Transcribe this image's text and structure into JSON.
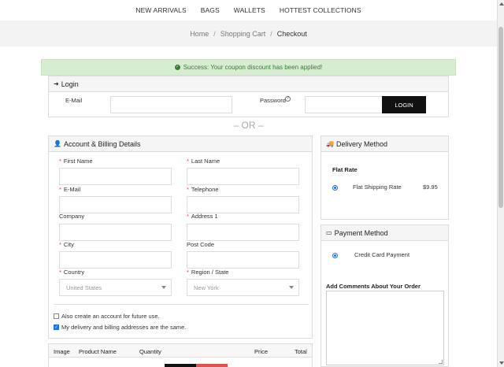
{
  "nav": {
    "items": [
      "NEW ARRIVALS",
      "BAGS",
      "WALLETS",
      "HOTTEST COLLECTIONS"
    ]
  },
  "breadcrumb": {
    "home": "Home",
    "cart": "Shopping Cart",
    "current": "Checkout",
    "separator": "/"
  },
  "alert": {
    "message": "Success: Your coupon discount has been applied!",
    "color": "#3c7a35"
  },
  "login": {
    "title": "Login",
    "email_label": "E-Mail",
    "password_label": "Password",
    "button": "LOGIN"
  },
  "divider": "– OR –",
  "billing": {
    "title": "Account & Billing Details",
    "first_name": "First Name",
    "last_name": "Last Name",
    "email": "E-Mail",
    "telephone": "Telephone",
    "company": "Company",
    "address1": "Address 1",
    "city": "City",
    "post_code": "Post Code",
    "country": "Country",
    "country_value": "United States",
    "region": "Region / State",
    "region_value": "New York",
    "create_account": "Also create an account for future use.",
    "same_address": "My delivery and billing addresses are the same."
  },
  "cart": {
    "headers": [
      "Image",
      "Product Name",
      "Quantity",
      "Price",
      "Total"
    ]
  },
  "delivery": {
    "title": "Delivery Method",
    "group": "Flat Rate",
    "option": "Flat Shipping Rate",
    "price": "$9.95"
  },
  "payment": {
    "title": "Payment Method",
    "option": "Credit Card Payment",
    "comments_label": "Add Comments About Your Order"
  }
}
